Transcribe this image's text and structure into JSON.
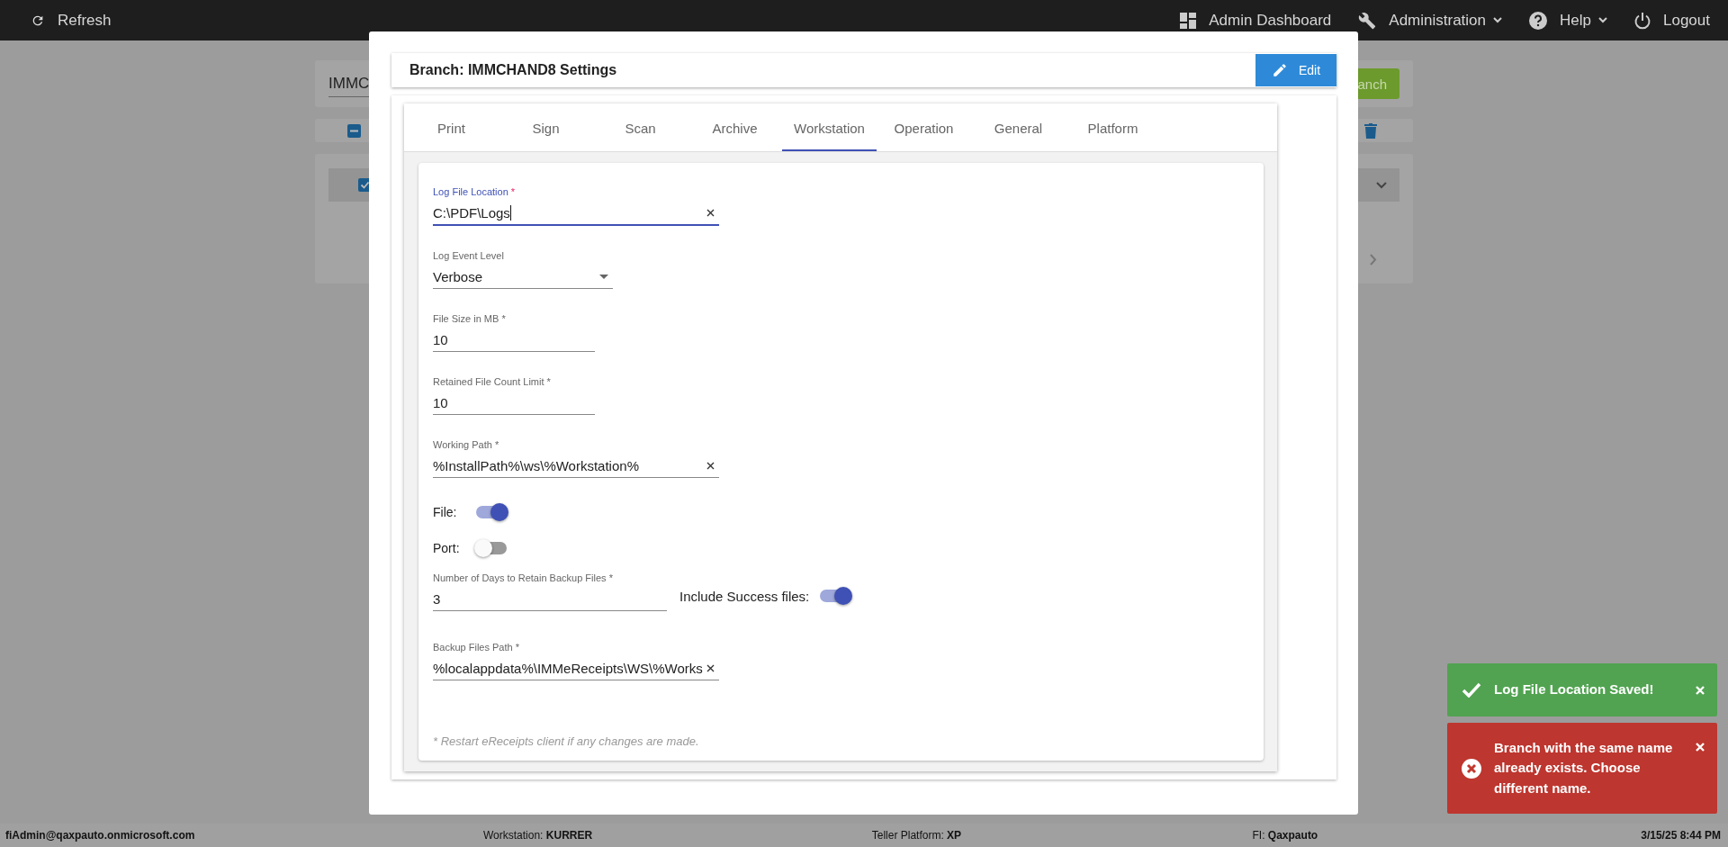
{
  "top_bar": {
    "left": [
      {
        "label": "Refresh"
      }
    ],
    "right": [
      {
        "label": "Admin Dashboard",
        "dropdown": false
      },
      {
        "label": "Administration",
        "dropdown": true
      },
      {
        "label": "Help",
        "dropdown": true
      },
      {
        "label": "Logout",
        "dropdown": false
      }
    ]
  },
  "background_page": {
    "search_value": "IMMC",
    "button": "anch",
    "row_checked": true
  },
  "dialog": {
    "title": "Branch: IMMCHAND8 Settings",
    "edit_button": "Edit",
    "tabs": [
      {
        "label": "Print",
        "selected": false
      },
      {
        "label": "Sign",
        "selected": false
      },
      {
        "label": "Scan",
        "selected": false
      },
      {
        "label": "Archive",
        "selected": false
      },
      {
        "label": "Workstation",
        "selected": true
      },
      {
        "label": "Operation",
        "selected": false
      },
      {
        "label": "General",
        "selected": false
      },
      {
        "label": "Platform",
        "selected": false
      }
    ],
    "fields": [
      {
        "kind": "path",
        "label": "Log File Location",
        "required_mark": "*",
        "value": "C:\\PDF\\Logs",
        "focused": true
      },
      {
        "kind": "select",
        "label": "Log Event Level",
        "value": "Verbose",
        "focused": false
      },
      {
        "kind": "number",
        "label": "File Size in MB",
        "required_mark": "*",
        "value": "10",
        "focused": false
      },
      {
        "kind": "number",
        "label": "Retained File Count Limit",
        "required_mark": "*",
        "value": "10",
        "focused": false
      },
      {
        "kind": "path",
        "label": "Working Path",
        "required_mark": "*",
        "value": "%InstallPath%\\ws\\%Workstation%",
        "focused": false
      },
      {
        "kind": "toggle",
        "label": "File:",
        "on": true
      },
      {
        "kind": "toggle",
        "label": "Port:",
        "on": false
      },
      {
        "kind": "number",
        "label": "Number of Days to Retain Backup Files",
        "required_mark": "*",
        "value": "3",
        "focused": false,
        "side_toggle": {
          "label": "Include Success files:",
          "on": true
        }
      },
      {
        "kind": "path",
        "label": "Backup Files Path",
        "required_mark": "*",
        "value": "%localappdata%\\IMMeReceipts\\WS\\%Works",
        "focused": false
      }
    ],
    "footnote": "* Restart eReceipts client if any changes are made."
  },
  "toasts": [
    {
      "kind": "success",
      "message": "Log File Location Saved!"
    },
    {
      "kind": "error",
      "message": "Branch with the same name already exists. Choose different name."
    }
  ],
  "status_bar": {
    "user": "fiAdmin@qaxpauto.onmicrosoft.com",
    "items": [
      {
        "label": "Workstation:",
        "value": "KURRER"
      },
      {
        "label": "Teller Platform:",
        "value": "XP"
      },
      {
        "label": "FI:",
        "value": "Qaxpauto"
      }
    ],
    "datetime": "3/15/25 8:44 PM"
  }
}
